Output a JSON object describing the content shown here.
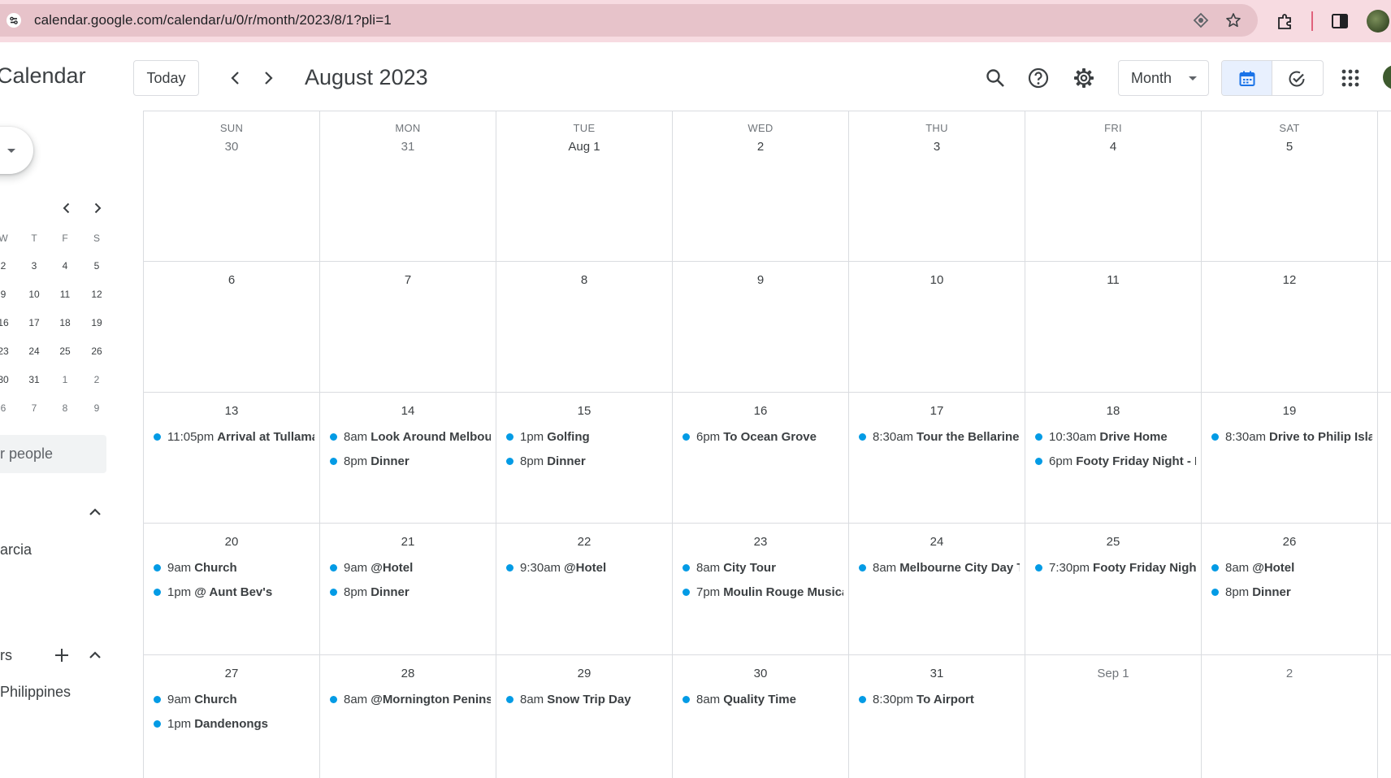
{
  "browser": {
    "url": "calendar.google.com/calendar/u/0/r/month/2023/8/1?pli=1"
  },
  "header": {
    "app_title": "Calendar",
    "today_label": "Today",
    "month_title": "August 2023",
    "view_label": "Month"
  },
  "sidebar": {
    "mini_calendar": {
      "weekday_heads": [
        "W",
        "T",
        "F",
        "S"
      ],
      "rows": [
        [
          "2",
          "3",
          "4",
          "5"
        ],
        [
          "9",
          "10",
          "11",
          "12"
        ],
        [
          "16",
          "17",
          "18",
          "19"
        ],
        [
          "23",
          "24",
          "25",
          "26"
        ],
        [
          "30",
          "31",
          "1",
          "2"
        ],
        [
          "6",
          "7",
          "8",
          "9"
        ]
      ]
    },
    "search_people_placeholder": "or people",
    "my_calendars_item": "arcia",
    "other_calendars_label": "rs",
    "other_calendars_item": "Philippines"
  },
  "grid": {
    "weekdays": [
      "SUN",
      "MON",
      "TUE",
      "WED",
      "THU",
      "FRI",
      "SAT"
    ],
    "weeks": [
      {
        "days": [
          {
            "num": "30",
            "other": true,
            "events": []
          },
          {
            "num": "31",
            "other": true,
            "events": []
          },
          {
            "num": "Aug 1",
            "events": []
          },
          {
            "num": "2",
            "events": []
          },
          {
            "num": "3",
            "events": []
          },
          {
            "num": "4",
            "events": []
          },
          {
            "num": "5",
            "events": []
          }
        ]
      },
      {
        "days": [
          {
            "num": "6",
            "events": []
          },
          {
            "num": "7",
            "events": []
          },
          {
            "num": "8",
            "events": []
          },
          {
            "num": "9",
            "events": []
          },
          {
            "num": "10",
            "events": []
          },
          {
            "num": "11",
            "events": []
          },
          {
            "num": "12",
            "events": []
          }
        ]
      },
      {
        "days": [
          {
            "num": "13",
            "events": [
              {
                "time": "11:05pm",
                "name": "Arrival at Tullama"
              }
            ]
          },
          {
            "num": "14",
            "events": [
              {
                "time": "8am",
                "name": "Look Around Melbour"
              },
              {
                "time": "8pm",
                "name": "Dinner"
              }
            ]
          },
          {
            "num": "15",
            "events": [
              {
                "time": "1pm",
                "name": "Golfing"
              },
              {
                "time": "8pm",
                "name": "Dinner"
              }
            ]
          },
          {
            "num": "16",
            "events": [
              {
                "time": "6pm",
                "name": "To Ocean Grove"
              }
            ]
          },
          {
            "num": "17",
            "events": [
              {
                "time": "8:30am",
                "name": "Tour the Bellarine"
              }
            ]
          },
          {
            "num": "18",
            "events": [
              {
                "time": "10:30am",
                "name": "Drive Home"
              },
              {
                "time": "6pm",
                "name": "Footy Friday Night - M"
              }
            ]
          },
          {
            "num": "19",
            "events": [
              {
                "time": "8:30am",
                "name": "Drive to Philip Islar"
              }
            ]
          }
        ]
      },
      {
        "days": [
          {
            "num": "20",
            "events": [
              {
                "time": "9am",
                "name": "Church"
              },
              {
                "time": "1pm",
                "name": "@ Aunt Bev's"
              }
            ]
          },
          {
            "num": "21",
            "events": [
              {
                "time": "9am",
                "name": "@Hotel"
              },
              {
                "time": "8pm",
                "name": "Dinner"
              }
            ]
          },
          {
            "num": "22",
            "events": [
              {
                "time": "9:30am",
                "name": "@Hotel"
              }
            ]
          },
          {
            "num": "23",
            "events": [
              {
                "time": "8am",
                "name": "City Tour"
              },
              {
                "time": "7pm",
                "name": "Moulin Rouge Musica"
              }
            ]
          },
          {
            "num": "24",
            "events": [
              {
                "time": "8am",
                "name": "Melbourne City Day T"
              }
            ]
          },
          {
            "num": "25",
            "events": [
              {
                "time": "7:30pm",
                "name": "Footy Friday Night"
              }
            ]
          },
          {
            "num": "26",
            "events": [
              {
                "time": "8am",
                "name": "@Hotel"
              },
              {
                "time": "8pm",
                "name": "Dinner"
              }
            ]
          }
        ]
      },
      {
        "days": [
          {
            "num": "27",
            "events": [
              {
                "time": "9am",
                "name": "Church"
              },
              {
                "time": "1pm",
                "name": "Dandenongs"
              }
            ]
          },
          {
            "num": "28",
            "events": [
              {
                "time": "8am",
                "name": "@Mornington Peninsu"
              }
            ]
          },
          {
            "num": "29",
            "events": [
              {
                "time": "8am",
                "name": "Snow Trip Day"
              }
            ]
          },
          {
            "num": "30",
            "events": [
              {
                "time": "8am",
                "name": "Quality Time"
              }
            ]
          },
          {
            "num": "31",
            "events": [
              {
                "time": "8:30pm",
                "name": "To Airport"
              }
            ]
          },
          {
            "num": "Sep 1",
            "other": true,
            "events": []
          },
          {
            "num": "2",
            "other": true,
            "events": []
          }
        ]
      }
    ]
  },
  "colors": {
    "event_dot": "#039be5",
    "chrome_bg": "#f7dbe1",
    "active_toggle": "#e8f0fe"
  }
}
